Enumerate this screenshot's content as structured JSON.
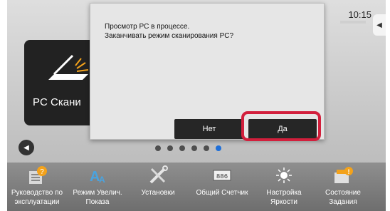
{
  "status": {
    "time": "10:15"
  },
  "home": {
    "tile_label": "PC Скани",
    "tile_icon": "scanner-icon",
    "page_dots": 6,
    "active_dot": 5
  },
  "dialog": {
    "line1": "Просмотр PC в процессе.",
    "line2": "Заканчивать режим сканирования PC?",
    "no_label": "Нет",
    "yes_label": "Да",
    "highlight_color": "#d21f3c"
  },
  "taskbar": {
    "items": [
      {
        "line1": "Руководство по",
        "line2": "эксплуатации",
        "icon": "manual-icon"
      },
      {
        "line1": "Режим Увелич.",
        "line2": "Показа",
        "icon": "magnify-text-icon"
      },
      {
        "line1": "Установки",
        "line2": "",
        "icon": "tools-icon"
      },
      {
        "line1": "Общий Счетчик",
        "line2": "",
        "icon": "counter-icon"
      },
      {
        "line1": "Настройка",
        "line2": "Яркости",
        "icon": "brightness-icon"
      },
      {
        "line1": "Состояние",
        "line2": "Задания",
        "icon": "job-status-icon"
      }
    ]
  }
}
